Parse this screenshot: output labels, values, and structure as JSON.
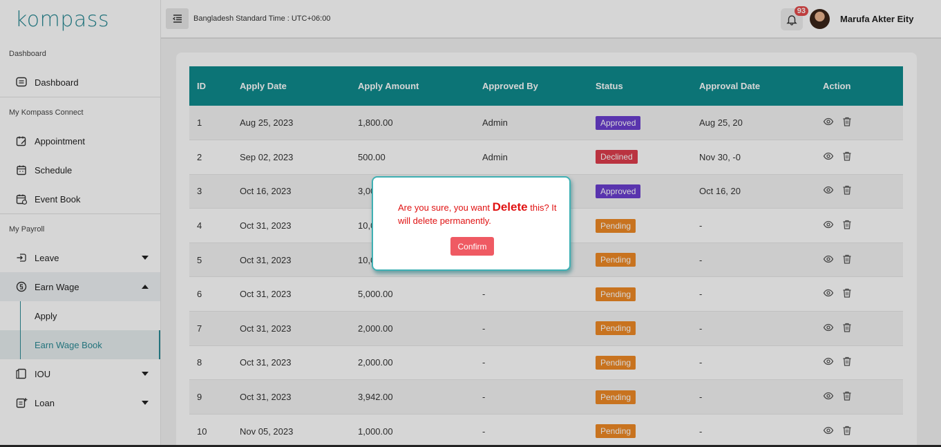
{
  "brand": {
    "logo_text": "kompass"
  },
  "topbar": {
    "timezone": "Bangladesh Standard Time : UTC+06:00",
    "notif_count": "93",
    "user_name": "Marufa Akter Eity"
  },
  "sidebar": {
    "sec_dashboard": "Dashboard",
    "dashboard": "Dashboard",
    "sec_connect": "My Kompass Connect",
    "appointment": "Appointment",
    "schedule": "Schedule",
    "event_book": "Event Book",
    "sec_payroll": "My Payroll",
    "leave": "Leave",
    "earn_wage": "Earn Wage",
    "apply": "Apply",
    "earn_wage_book": "Earn Wage Book",
    "iou": "IOU",
    "loan": "Loan"
  },
  "table": {
    "headers": [
      "ID",
      "Apply Date",
      "Apply Amount",
      "Approved By",
      "Status",
      "Approval Date",
      "Action"
    ],
    "rows": [
      [
        "1",
        "Aug 25, 2023",
        "1,800.00",
        "Admin",
        "Approved",
        "Aug 25, 20"
      ],
      [
        "2",
        "Sep 02, 2023",
        "500.00",
        "Admin",
        "Declined",
        "Nov 30, -0"
      ],
      [
        "3",
        "Oct 16, 2023",
        "3,00",
        "",
        "Approved",
        "Oct 16, 20"
      ],
      [
        "4",
        "Oct 31, 2023",
        "10,0",
        "",
        "Pending",
        "-"
      ],
      [
        "5",
        "Oct 31, 2023",
        "10,0",
        "",
        "Pending",
        "-"
      ],
      [
        "6",
        "Oct 31, 2023",
        "5,000.00",
        "-",
        "Pending",
        "-"
      ],
      [
        "7",
        "Oct 31, 2023",
        "2,000.00",
        "-",
        "Pending",
        "-"
      ],
      [
        "8",
        "Oct 31, 2023",
        "2,000.00",
        "-",
        "Pending",
        "-"
      ],
      [
        "9",
        "Oct 31, 2023",
        "3,942.00",
        "-",
        "Pending",
        "-"
      ],
      [
        "10",
        "Nov 05, 2023",
        "1,000.00",
        "-",
        "Pending",
        "-"
      ]
    ]
  },
  "modal": {
    "msg_prefix": "Are you sure, you want ",
    "msg_strong": "Delete",
    "msg_suffix": " this? It will delete permanently.",
    "confirm": "Confirm"
  },
  "colors": {
    "brand": "#2a8a94",
    "header": "#0f8b8d",
    "approved": "#6a3fd0",
    "declined": "#de3d4d",
    "pending": "#ef8a26"
  }
}
